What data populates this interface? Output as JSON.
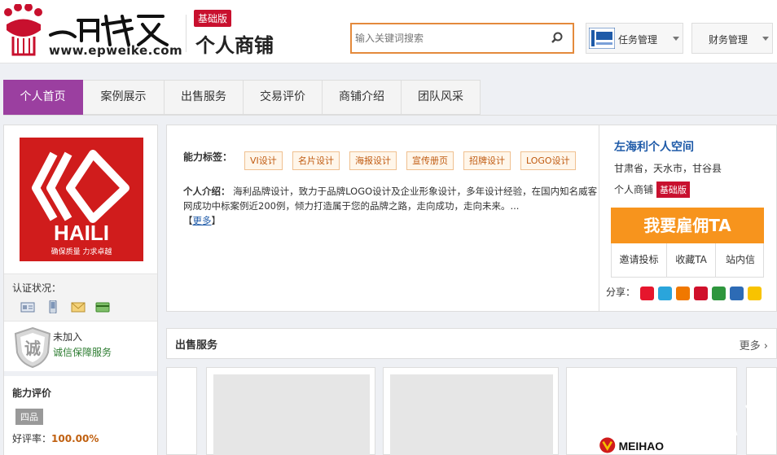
{
  "header": {
    "logo_url": "www.epweike.com",
    "edition_badge": "基础版",
    "shop_title": "个人商铺",
    "search_placeholder": "输入关键词搜索",
    "task_menu_label": "任务管理",
    "finance_menu_label": "财务管理",
    "accent_color": "#e48a3c"
  },
  "nav": {
    "tabs": [
      {
        "label": "个人首页",
        "active": true
      },
      {
        "label": "案例展示"
      },
      {
        "label": "出售服务"
      },
      {
        "label": "交易评价"
      },
      {
        "label": "商铺介绍"
      },
      {
        "label": "团队风采"
      }
    ],
    "active_color": "#9b3fa0"
  },
  "sidebar": {
    "avatar_brand": "HAILI",
    "avatar_slogan": "确保质量 力求卓越",
    "verify_title": "认证状况：",
    "verify_icons": [
      "id-card-icon",
      "phone-icon",
      "email-icon",
      "bank-card-icon"
    ],
    "honesty_status": "未加入",
    "honesty_link": "诚信保障服务",
    "rating_title": "能力评价",
    "level": "四品",
    "praise_label": "好评率：",
    "praise_value": "100.00%"
  },
  "profile": {
    "skills_label": "能力标签：",
    "skills": [
      "VI设计",
      "名片设计",
      "海报设计",
      "宣传册页",
      "招牌设计",
      "LOGO设计"
    ],
    "intro_label": "个人介绍：",
    "intro_text": "海利品牌设计，致力于品牌LOGO设计及企业形象设计，多年设计经验，在国内知名威客网成功中标案例近200例，倾力打造属于您的品牌之路，走向成功，走向未来。...",
    "more_prefix": "【",
    "more_label": "更多",
    "more_suffix": "】"
  },
  "shop_card": {
    "space_name": "左海利个人空间",
    "location": "甘肃省，天水市，甘谷县",
    "shop_type": "个人商铺",
    "shop_badge": "基础版",
    "hire_label": "我要雇佣TA",
    "actions": [
      "邀请投标",
      "收藏TA",
      "站内信"
    ],
    "share_label": "分享：",
    "share_icons": [
      "weibo-icon",
      "tencent-weibo-icon",
      "tianya-icon",
      "kaixin-icon",
      "douban-icon",
      "renren-icon",
      "qzone-icon"
    ]
  },
  "services": {
    "title": "出售服务",
    "more_label": "更多",
    "card_logo_text": "MEIHAO"
  }
}
